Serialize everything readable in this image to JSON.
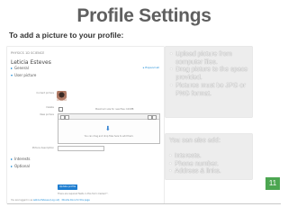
{
  "slide": {
    "title": "Profile Settings",
    "subtitle": "To add a picture to your profile:",
    "page_number": "11"
  },
  "screenshot": {
    "breadcrumb": "PHYSICS 1D SCIENCE",
    "user_name": "Leticia Esteves",
    "collapse_all": "▸ Expand all",
    "sections": {
      "general": "General",
      "user_picture": "User picture",
      "interests": "Interests",
      "optional": "Optional"
    },
    "labels": {
      "current_picture": "Current picture",
      "delete": "Delete",
      "new_picture": "New picture",
      "picture_description": "Picture description"
    },
    "max_size": "Maximum size for new files: 100MB",
    "drop_hint": "You can drag and drop files here to add them.",
    "update_button": "Update profile",
    "required_note": "There are required fields in this form marked *.",
    "footer_prefix": "You are logged in as ",
    "footer_user": "Leticia Esteves",
    "footer_logout": "(Log out)",
    "footer_help": "Moodle Docs for this page"
  },
  "callout_upload": {
    "items": [
      "Upload picture from computer files.",
      "Drag picture to the space provided.",
      "Pictures must be JPG or PNG format."
    ]
  },
  "callout_also": {
    "intro": "You can also add:",
    "items": [
      "Interests.",
      "Phone number.",
      "Address & links."
    ]
  },
  "colors": {
    "title": "#5f5f5f",
    "box_bg": "#ededed",
    "page_badge": "#4ca651",
    "moodle_accent": "#1d7dd0"
  }
}
